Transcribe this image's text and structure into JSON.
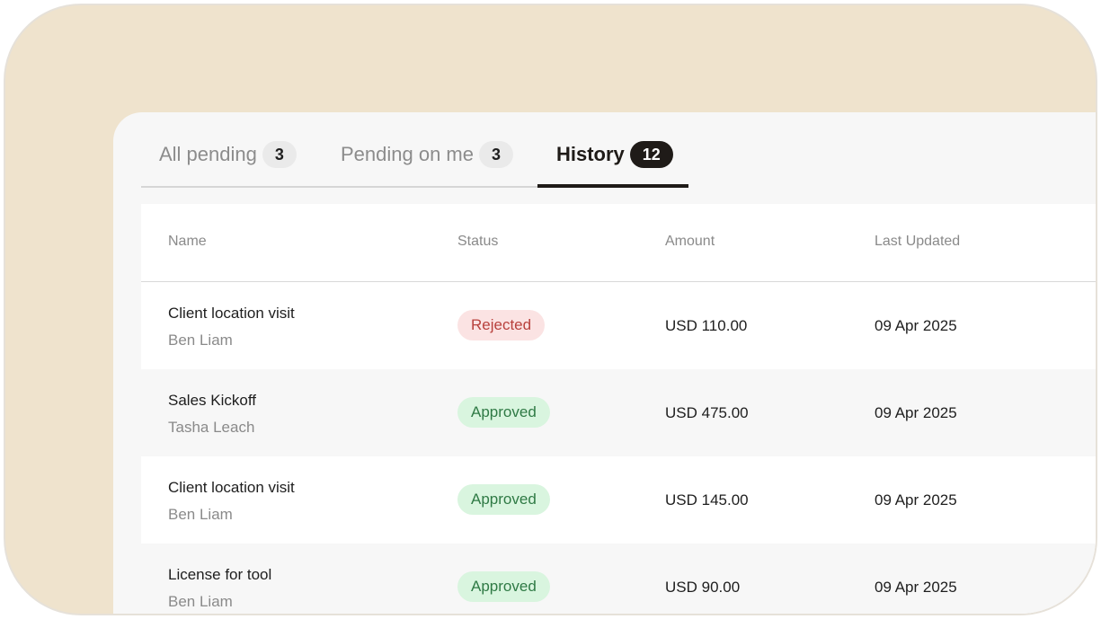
{
  "tabs": [
    {
      "label": "All pending",
      "count": "3"
    },
    {
      "label": "Pending on me",
      "count": "3"
    },
    {
      "label": "History",
      "count": "12",
      "active": true
    }
  ],
  "table": {
    "headers": {
      "name": "Name",
      "status": "Status",
      "amount": "Amount",
      "updated": "Last Updated"
    },
    "rows": [
      {
        "title": "Client location visit",
        "person": "Ben Liam",
        "status": "Rejected",
        "amount": "USD 110.00",
        "updated": "09 Apr 2025"
      },
      {
        "title": "Sales Kickoff",
        "person": "Tasha Leach",
        "status": "Approved",
        "amount": "USD 475.00",
        "updated": "09 Apr 2025"
      },
      {
        "title": "Client location visit",
        "person": "Ben Liam",
        "status": "Approved",
        "amount": "USD 145.00",
        "updated": "09 Apr 2025"
      },
      {
        "title": "License for tool",
        "person": "Ben Liam",
        "status": "Approved",
        "amount": "USD 90.00",
        "updated": "09 Apr 2025"
      }
    ]
  },
  "colors": {
    "background": "#efe3cd",
    "active_tab": "#1f1b18",
    "rejected_bg": "#fbe3e3",
    "rejected_text": "#b8413d",
    "approved_bg": "#d9f5df",
    "approved_text": "#2f7a45"
  }
}
